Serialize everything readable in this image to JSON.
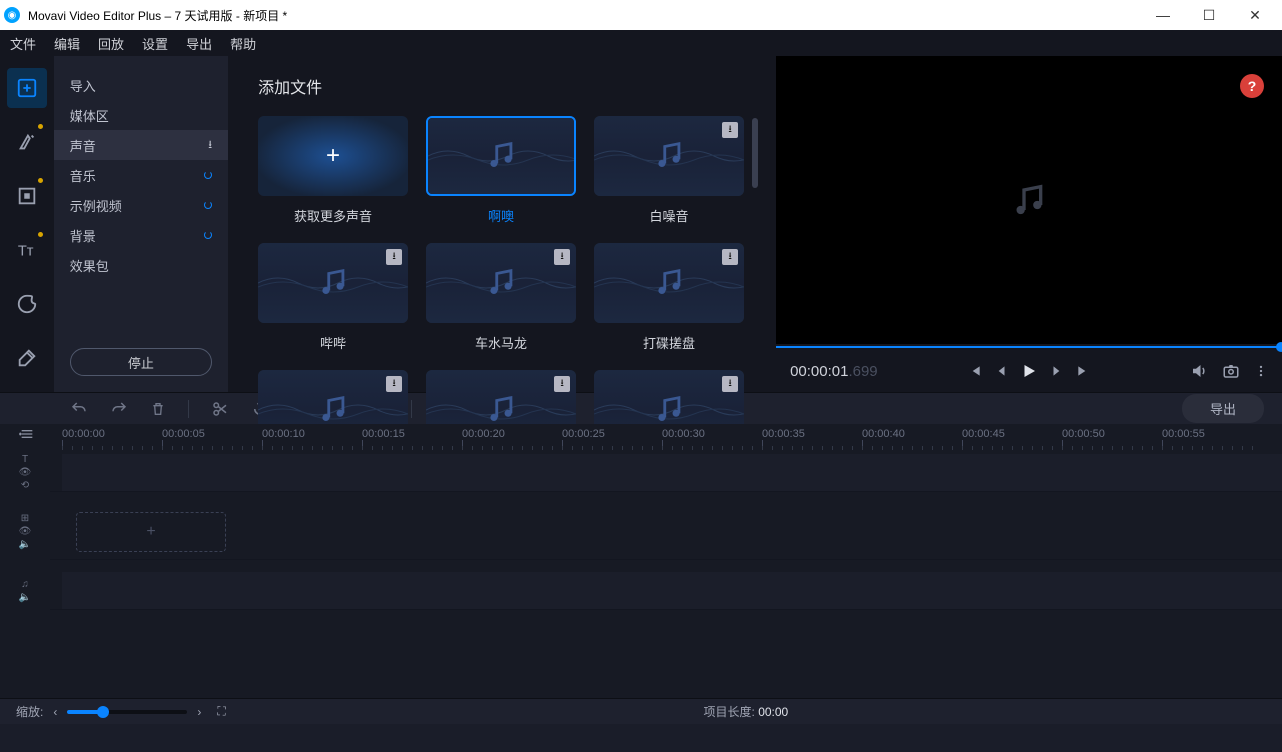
{
  "window": {
    "title": "Movavi Video Editor Plus – 7 天试用版 - 新项目 *"
  },
  "menubar": [
    "文件",
    "编辑",
    "回放",
    "设置",
    "导出",
    "帮助"
  ],
  "import": {
    "items": [
      {
        "label": "导入",
        "icon": "none"
      },
      {
        "label": "媒体区",
        "icon": "none"
      },
      {
        "label": "声音",
        "icon": "download",
        "active": true
      },
      {
        "label": "音乐",
        "icon": "loading"
      },
      {
        "label": "示例视频",
        "icon": "loading"
      },
      {
        "label": "背景",
        "icon": "loading"
      },
      {
        "label": "效果包",
        "icon": "none"
      }
    ],
    "stop": "停止"
  },
  "content": {
    "title": "添加文件",
    "tiles": [
      {
        "label": "获取更多声音",
        "kind": "plus"
      },
      {
        "label": "啊噢",
        "kind": "music",
        "selected": true,
        "dl": false
      },
      {
        "label": "白噪音",
        "kind": "music",
        "dl": true
      },
      {
        "label": "哔哔",
        "kind": "music",
        "dl": true
      },
      {
        "label": "车水马龙",
        "kind": "music",
        "dl": true
      },
      {
        "label": "打碟搓盘",
        "kind": "music",
        "dl": true
      },
      {
        "label": "",
        "kind": "music",
        "dl": true
      },
      {
        "label": "",
        "kind": "music",
        "dl": true
      },
      {
        "label": "",
        "kind": "music",
        "dl": true
      }
    ]
  },
  "preview": {
    "timecode_main": "00:00:01",
    "timecode_ms": ".699",
    "help": "?"
  },
  "toolbar": {
    "export": "导出"
  },
  "timeline": {
    "ruler": [
      "00:00:00",
      "00:00:05",
      "00:00:10",
      "00:00:15",
      "00:00:20",
      "00:00:25",
      "00:00:30",
      "00:00:35",
      "00:00:40",
      "00:00:45",
      "00:00:50",
      "00:00:55"
    ]
  },
  "bottom": {
    "zoom_label": "缩放:",
    "project_length_label": "项目长度:",
    "project_length_value": "00:00"
  }
}
